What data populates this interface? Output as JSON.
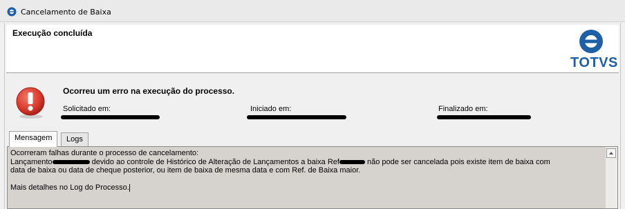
{
  "window": {
    "title": "Cancelamento de Baixa"
  },
  "header": {
    "title": "Execução concluída",
    "logo_text": "TOTVS"
  },
  "status": {
    "message": "Ocorreu um erro na execução do processo.",
    "requested_label": "Solicitado em:",
    "started_label": "Iniciado em:",
    "finished_label": "Finalizado em:"
  },
  "tabs": [
    {
      "label": "Mensagem",
      "active": true
    },
    {
      "label": "Logs",
      "active": false
    }
  ],
  "message": {
    "line1": "Ocorreram falhas durante o processo de cancelamento:",
    "line2_a": "Lançamento",
    "line2_b": " devido ao controle de Histórico de Alteração de Lançamentos a baixa Ref",
    "line2_c": " não pode ser cancelada pois existe item de baixa com",
    "line3": "data de baixa ou data de cheque posterior, ou item de baixa de mesma data e com Ref. de Baixa maior.",
    "line5": "Mais detalhes no Log do Processo."
  },
  "colors": {
    "accent": "#1f5fa6",
    "error_icon": "#d8392b"
  },
  "icons": {
    "title": "totvs-logo-icon",
    "error": "error-exclamation-icon",
    "scroll": "scroll-up-arrow-icon"
  }
}
